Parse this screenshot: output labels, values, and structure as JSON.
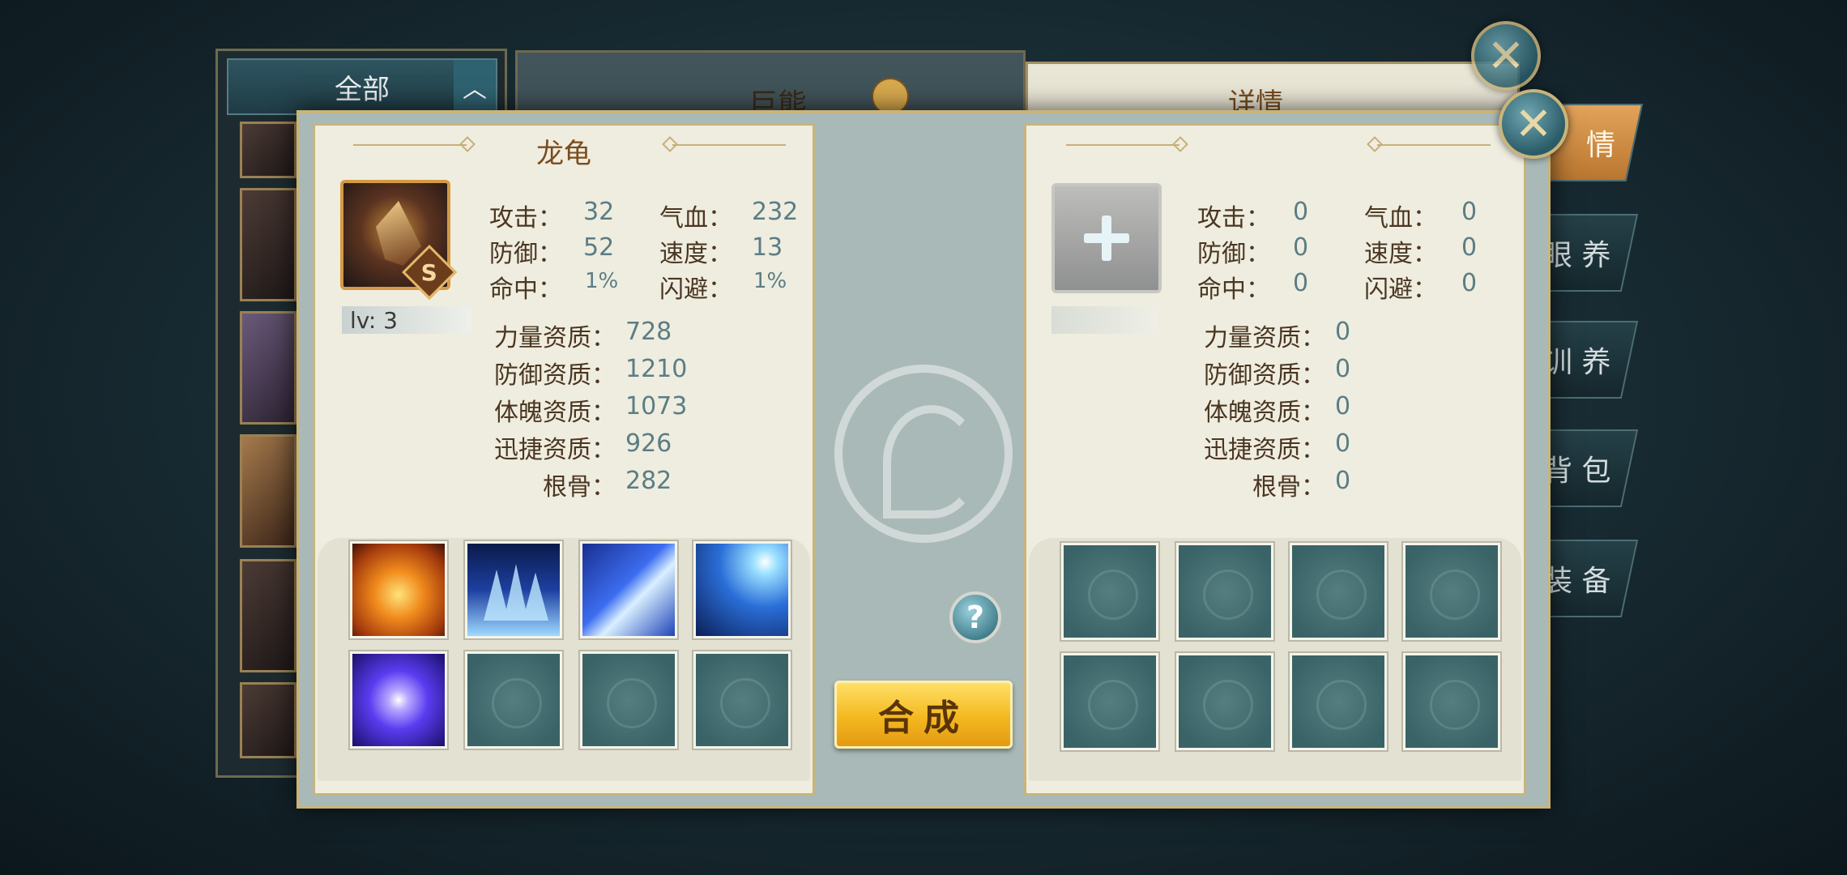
{
  "background": {
    "list_header": "全部",
    "list_toggle_icon": "chevron-up-icon",
    "pet_name": "巨熊",
    "detail_title": "详情",
    "side_tabs": [
      "情",
      "眼 养",
      "训 养",
      "背 包",
      "装 备"
    ]
  },
  "left_panel": {
    "title": "龙龟",
    "grade": "S",
    "level": "lv: 3",
    "stats": [
      {
        "label": "攻击：",
        "value": "32"
      },
      {
        "label": "气血：",
        "value": "232"
      },
      {
        "label": "防御：",
        "value": "52"
      },
      {
        "label": "速度：",
        "value": "13"
      },
      {
        "label": "命中：",
        "value": "1%"
      },
      {
        "label": "闪避：",
        "value": "1%"
      }
    ],
    "aptitudes": [
      {
        "label": "力量资质：",
        "value": "728"
      },
      {
        "label": "防御资质：",
        "value": "1210"
      },
      {
        "label": "体魄资质：",
        "value": "1073"
      },
      {
        "label": "迅捷资质：",
        "value": "926"
      },
      {
        "label": "根骨：",
        "value": "282"
      }
    ],
    "skills": [
      "flame-shield-skill",
      "ice-spikes-skill",
      "lightning-slash-skill",
      "thunder-storm-skill",
      "arcane-orb-skill",
      "empty",
      "empty",
      "empty"
    ]
  },
  "right_panel": {
    "stats": [
      {
        "label": "攻击：",
        "value": "0"
      },
      {
        "label": "气血：",
        "value": "0"
      },
      {
        "label": "防御：",
        "value": "0"
      },
      {
        "label": "速度：",
        "value": "0"
      },
      {
        "label": "命中：",
        "value": "0"
      },
      {
        "label": "闪避：",
        "value": "0"
      }
    ],
    "aptitudes": [
      {
        "label": "力量资质：",
        "value": "0"
      },
      {
        "label": "防御资质：",
        "value": "0"
      },
      {
        "label": "体魄资质：",
        "value": "0"
      },
      {
        "label": "迅捷资质：",
        "value": "0"
      },
      {
        "label": "根骨：",
        "value": "0"
      }
    ]
  },
  "center": {
    "compose_label": "合成",
    "help_label": "?",
    "close_label": "✕"
  },
  "colors": {
    "accent_gold": "#f4b81f",
    "label_brown": "#4a3622",
    "value_teal": "#5a7d86",
    "title_brown": "#7b4c1c"
  }
}
